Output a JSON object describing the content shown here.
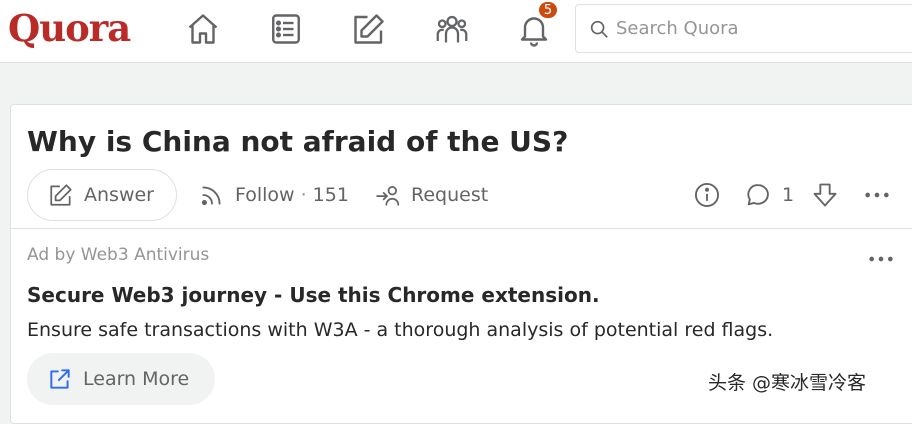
{
  "header": {
    "logo": "Quora",
    "nav": [
      {
        "icon": "home-icon"
      },
      {
        "icon": "list-icon"
      },
      {
        "icon": "edit-icon"
      },
      {
        "icon": "people-icon"
      },
      {
        "icon": "bell-icon"
      }
    ],
    "notification_count": "5",
    "search_placeholder": "Search Quora"
  },
  "question": {
    "title": "Why is China not afraid of the US?",
    "answer_label": "Answer",
    "follow_label": "Follow",
    "follow_separator": "·",
    "follow_count": "151",
    "request_label": "Request",
    "comment_count": "1"
  },
  "ad": {
    "by_line": "Ad by Web3 Antivirus",
    "title": "Secure Web3 journey - Use this Chrome extension.",
    "description": "Ensure safe transactions with W3A - a thorough analysis of potential red flags.",
    "cta_label": "Learn More"
  },
  "watermark": "头条 @寒冰雪冷客",
  "colors": {
    "brand": "#b92b27",
    "badge": "#cb4b10",
    "link_icon": "#2e69ff",
    "text": "#282829",
    "muted": "#636466"
  }
}
